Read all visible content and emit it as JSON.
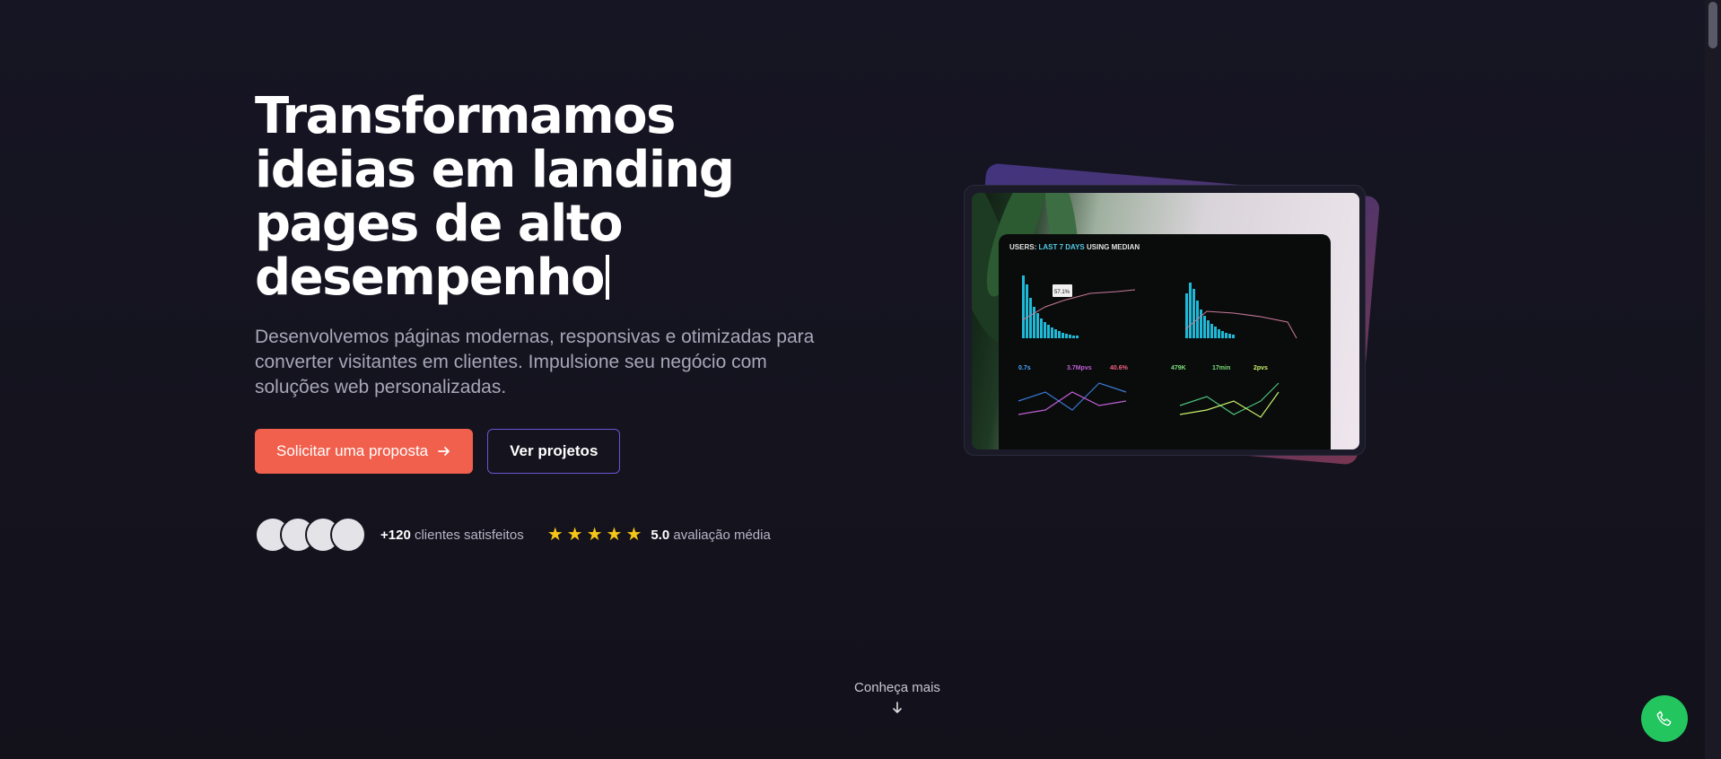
{
  "hero": {
    "headline_lines": [
      "Transformamos",
      "ideias em landing",
      "pages de alto",
      "desempenho"
    ],
    "subtitle": "Desenvolvemos páginas modernas, responsivas e otimizadas para converter visitantes em clientes. Impulsione seu negócio com soluções web personalizadas.",
    "primary_button": "Solicitar uma proposta",
    "primary_button_icon": "arrow-right-icon",
    "secondary_button": "Ver projetos"
  },
  "social_proof": {
    "clients_count": "+120",
    "clients_label": "clientes satisfeitos",
    "stars": 5,
    "rating_value": "5.0",
    "rating_label": "avaliação média"
  },
  "dashboard": {
    "title_prefix": "USERS:",
    "title_mid": "LAST 7 DAYS",
    "title_using": "USING",
    "title_suffix": "MEDIAN",
    "tooltip": "57.1%",
    "stats": [
      "0.7s",
      "3.7Mpvs",
      "40.6%",
      "479K",
      "17min",
      "2pvs"
    ]
  },
  "scroll_hint": {
    "label": "Conheça mais",
    "icon": "arrow-down-icon"
  },
  "fab": {
    "icon": "phone-icon"
  },
  "colors": {
    "background": "#15141f",
    "primary": "#f0604d",
    "secondary_border": "#6a55d6",
    "star": "#f5c518",
    "fab": "#22c55e"
  }
}
